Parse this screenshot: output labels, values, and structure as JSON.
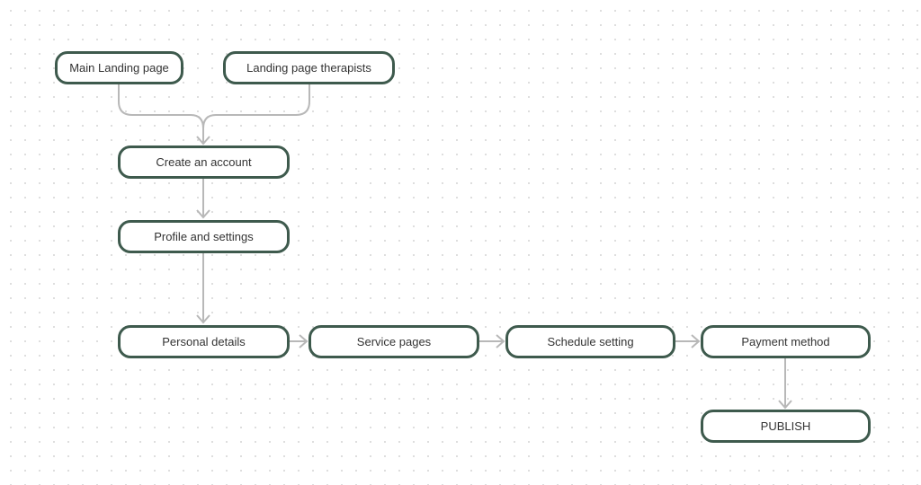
{
  "nodes": {
    "main_landing": "Main Landing page",
    "landing_therapists": "Landing page therapists",
    "create_account": "Create an account",
    "profile_settings": "Profile and settings",
    "personal_details": "Personal details",
    "service_pages": "Service pages",
    "schedule_setting": "Schedule setting",
    "payment_method": "Payment method",
    "publish": "PUBLISH"
  },
  "colors": {
    "node_border": "#3e5a4d",
    "connector": "#b8b8b8",
    "text": "#333333"
  }
}
